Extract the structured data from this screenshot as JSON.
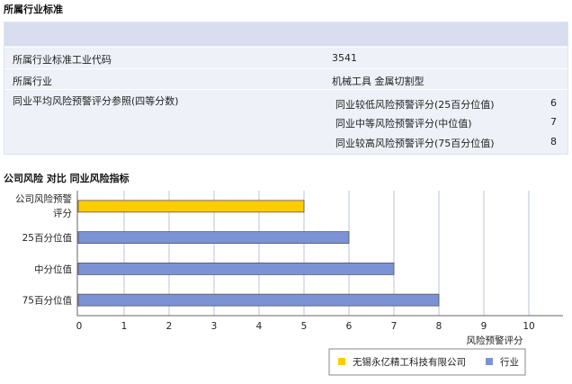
{
  "header": {
    "title": "所属行业标准"
  },
  "info": {
    "code_label": "所属行业标准工业代码",
    "code_value": "3541",
    "industry_label": "所属行业",
    "industry_value": "机械工具 金属切割型",
    "score_label": "同业平均风险预警评分参照(四等分数)",
    "scores": [
      {
        "label": "同业较低风险预警评分(25百分位值)",
        "value": "6"
      },
      {
        "label": "同业中等风险预警评分(中位值)",
        "value": "7"
      },
      {
        "label": "同业较高风险预警评分(75百分位值)",
        "value": "8"
      }
    ]
  },
  "chart_title": "公司风险 对比 同业风险指标",
  "chart_data": {
    "type": "bar",
    "orientation": "horizontal",
    "categories": [
      "公司风险预警评分",
      "25百分位值",
      "中分位值",
      "75百分位值"
    ],
    "category_lines": [
      [
        "公司风险预警",
        "评分"
      ],
      [
        "25百分位值"
      ],
      [
        "中分位值"
      ],
      [
        "75百分位值"
      ]
    ],
    "values": [
      5,
      6,
      7,
      8
    ],
    "bar_series": [
      0,
      1,
      1,
      1
    ],
    "series": [
      {
        "name": "无锡永亿精工科技有限公司",
        "color": "#ffcc00"
      },
      {
        "name": "行业",
        "color": "#7b93d4"
      }
    ],
    "xlabel": "风险预警评分",
    "xlim": [
      0,
      10
    ],
    "xticks": [
      0,
      1,
      2,
      3,
      4,
      5,
      6,
      7,
      8,
      9,
      10
    ],
    "grid": true,
    "legend_position": "bottom-right"
  }
}
